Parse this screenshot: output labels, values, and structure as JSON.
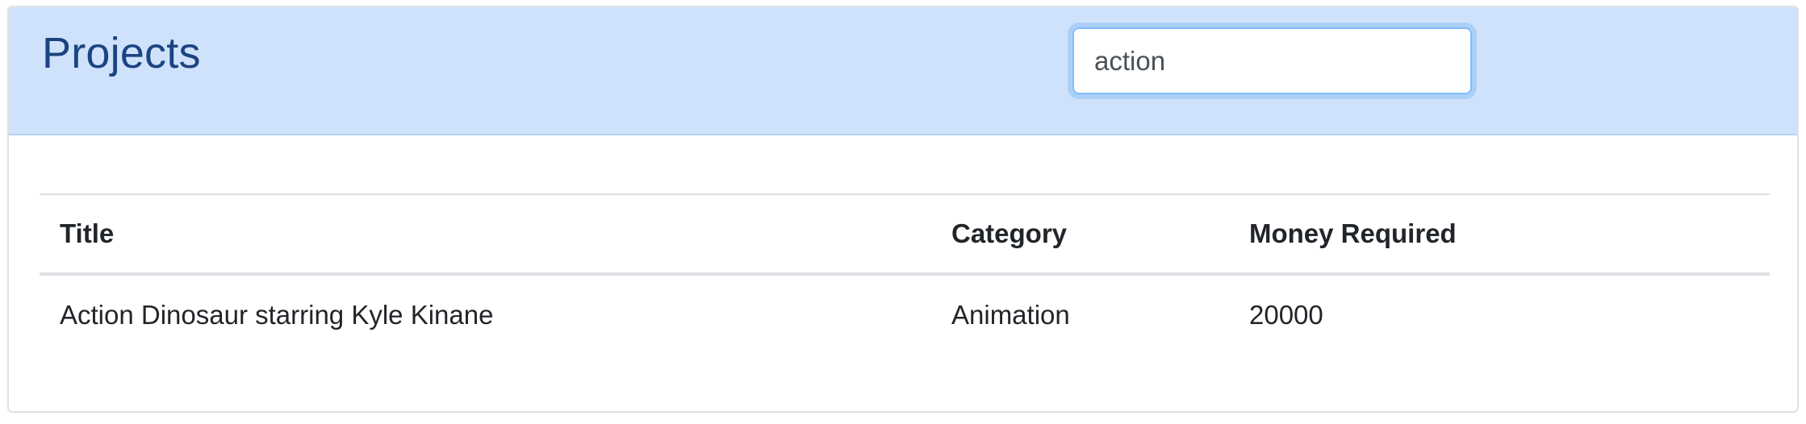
{
  "header": {
    "title": "Projects"
  },
  "search": {
    "value": "action",
    "placeholder": ""
  },
  "table": {
    "columns": [
      "Title",
      "Category",
      "Money Required"
    ],
    "rows": [
      {
        "title": "Action Dinosaur starring Kyle Kinane",
        "category": "Animation",
        "money_required": "20000"
      }
    ]
  },
  "colors": {
    "header_bg": "#cfe2fb",
    "title_color": "#1c4482",
    "focus_border": "#80bdff"
  }
}
